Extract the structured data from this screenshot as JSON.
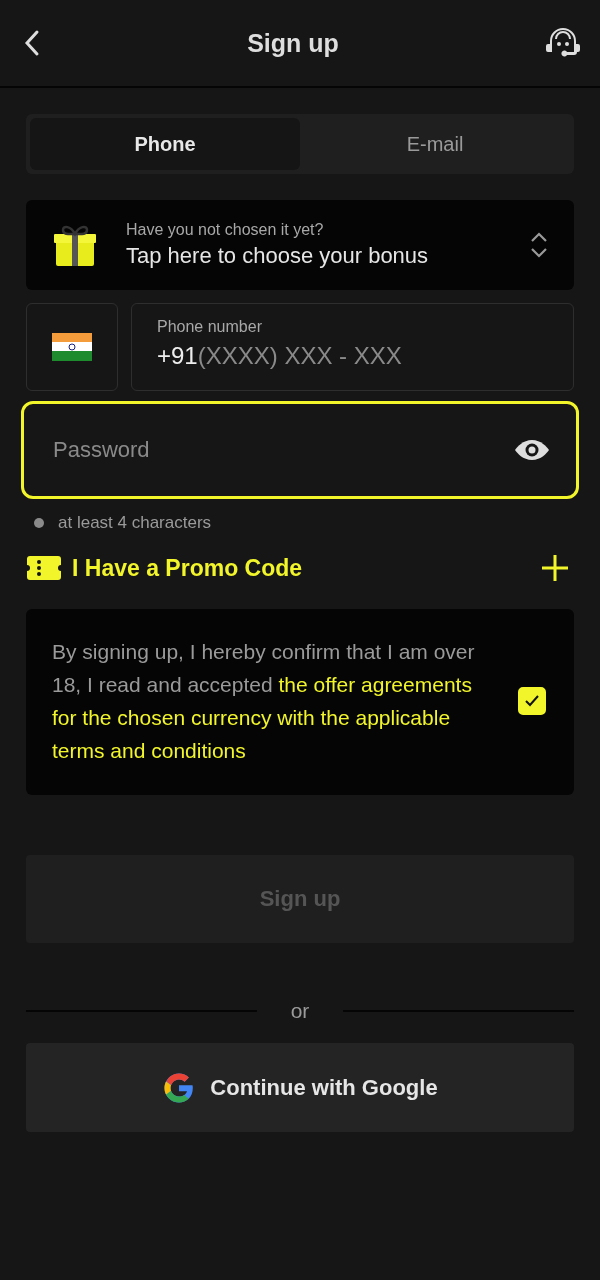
{
  "header": {
    "title": "Sign up"
  },
  "tabs": [
    {
      "label": "Phone",
      "selected": true
    },
    {
      "label": "E-mail",
      "selected": false
    }
  ],
  "bonus": {
    "hint": "Have you not chosen it yet?",
    "label": "Tap here to choose your bonus"
  },
  "phone": {
    "label": "Phone number",
    "code": "+91",
    "placeholder": "(XXXX) XXX - XXX"
  },
  "password": {
    "placeholder": "Password",
    "focused": true
  },
  "requirements": [
    {
      "text": "at least 4 characters",
      "met": false
    }
  ],
  "promo": {
    "label": "I Have a Promo Code"
  },
  "terms": {
    "text": "By signing up, I hereby confirm that I am over 18, I read and accepted",
    "highlight": "the offer agreements for the chosen currency with the applicable terms and conditions",
    "checked": true
  },
  "signup_button": {
    "label": "Sign up",
    "disabled": true
  },
  "divider": "or",
  "google_button": {
    "label": "Continue with Google"
  }
}
